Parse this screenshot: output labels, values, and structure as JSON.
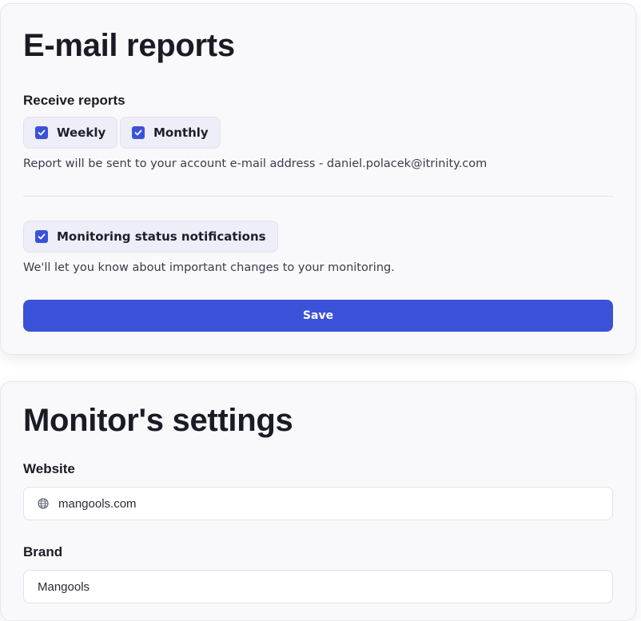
{
  "email_reports": {
    "title": "E-mail reports",
    "receive_label": "Receive reports",
    "options": [
      {
        "label": "Weekly",
        "checked": true
      },
      {
        "label": "Monthly",
        "checked": true
      }
    ],
    "report_note": "Report will be sent to your account e-mail address - daniel.polacek@itrinity.com",
    "monitoring_option": {
      "label": "Monitoring status notifications",
      "checked": true
    },
    "monitoring_note": "We'll let you know about important changes to your monitoring.",
    "save_label": "Save"
  },
  "monitor_settings": {
    "title": "Monitor's settings",
    "website": {
      "label": "Website",
      "value": "mangools.com",
      "icon": "globe-icon"
    },
    "brand": {
      "label": "Brand",
      "value": "Mangools"
    }
  },
  "colors": {
    "accent": "#3b52d8",
    "card_background": "#f9f9fc",
    "chip_background": "#eeeef8",
    "text": "#1e1f2b"
  }
}
